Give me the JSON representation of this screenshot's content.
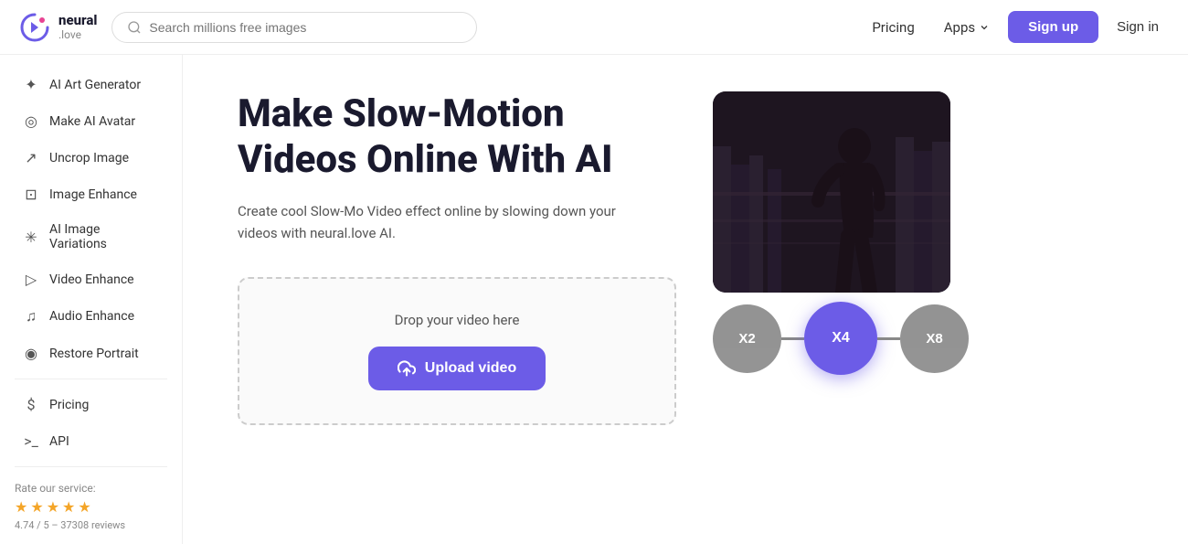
{
  "logo": {
    "name": "neural",
    "sub": ".love"
  },
  "header": {
    "search_placeholder": "Search millions free images",
    "nav_pricing": "Pricing",
    "nav_apps": "Apps",
    "btn_signup": "Sign up",
    "btn_signin": "Sign in"
  },
  "sidebar": {
    "items": [
      {
        "id": "ai-art-generator",
        "icon": "✦",
        "label": "AI Art Generator"
      },
      {
        "id": "make-ai-avatar",
        "icon": "◎",
        "label": "Make AI Avatar"
      },
      {
        "id": "uncrop-image",
        "icon": "↗",
        "label": "Uncrop Image"
      },
      {
        "id": "image-enhance",
        "icon": "⊡",
        "label": "Image Enhance"
      },
      {
        "id": "ai-image-variations",
        "icon": "✳",
        "label": "AI Image Variations"
      },
      {
        "id": "video-enhance",
        "icon": "▷",
        "label": "Video Enhance"
      },
      {
        "id": "audio-enhance",
        "icon": "♫",
        "label": "Audio Enhance"
      },
      {
        "id": "restore-portrait",
        "icon": "◉",
        "label": "Restore Portrait"
      }
    ],
    "bottom_items": [
      {
        "id": "pricing",
        "icon": "$",
        "label": "Pricing"
      },
      {
        "id": "api",
        "icon": ">_",
        "label": "API"
      }
    ],
    "rate_label": "Rate our service:",
    "stars": [
      true,
      true,
      true,
      true,
      true
    ],
    "rating_text": "4.74 / 5 – 37308 reviews"
  },
  "main": {
    "title_line1": "Make Slow-Motion",
    "title_line2": "Videos Online With AI",
    "description": "Create cool Slow-Mo Video effect online by slowing down your videos with neural.love AI.",
    "speed_options": [
      {
        "label": "X2",
        "active": false
      },
      {
        "label": "X4",
        "active": true
      },
      {
        "label": "X8",
        "active": false
      }
    ],
    "upload": {
      "hint": "Drop your video here",
      "btn_label": "Upload video"
    }
  }
}
